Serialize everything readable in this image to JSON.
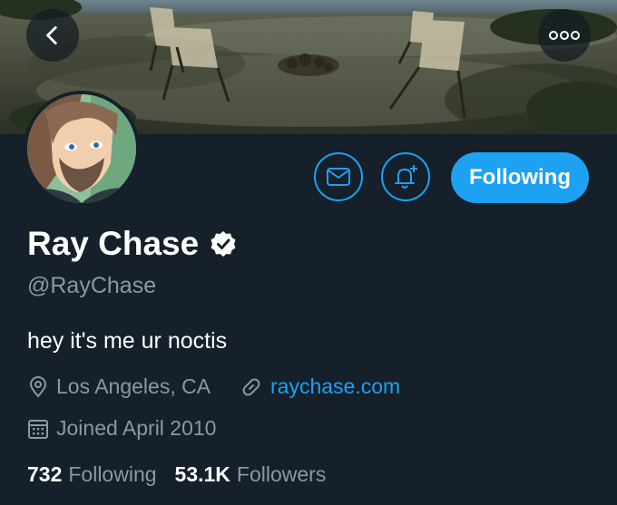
{
  "header": {
    "back_icon": "chevron-left-icon",
    "more_icon": "more-horizontal-icon"
  },
  "profile": {
    "name": "Ray Chase",
    "handle": "@RayChase",
    "bio": "hey it's me ur noctis",
    "location": "Los Angeles, CA",
    "website": "raychase.com",
    "joined": "Joined April 2010",
    "verified": true
  },
  "actions": {
    "message_icon": "mail-icon",
    "notify_icon": "bell-plus-icon",
    "following_label": "Following"
  },
  "stats": {
    "following_count": "732",
    "following_label": "Following",
    "followers_count": "53.1K",
    "followers_label": "Followers"
  },
  "colors": {
    "background": "#15202b",
    "accent": "#1da1f2",
    "secondary_text": "#8899a6",
    "primary_text": "#ffffff"
  }
}
